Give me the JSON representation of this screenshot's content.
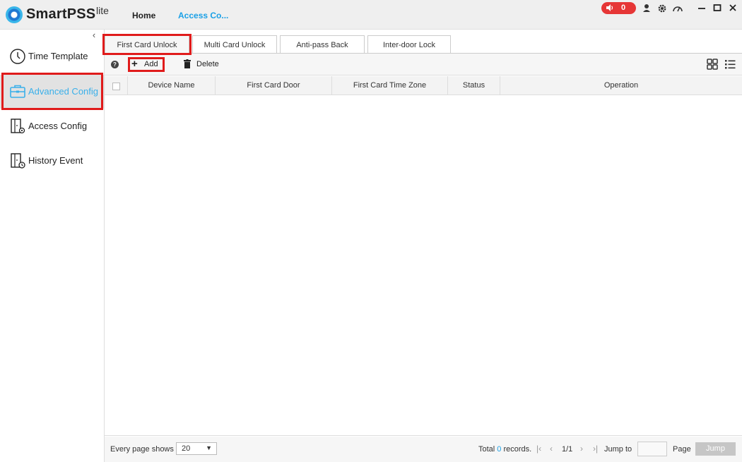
{
  "app": {
    "brand": "SmartPSS",
    "brand_sup": "lite",
    "nav": {
      "home": "Home",
      "access": "Access Co..."
    },
    "alarm_count": "0",
    "colors": {
      "accent": "#1aa0e6",
      "alarm": "#e63636",
      "highlight": "#e01b1b"
    },
    "icons": [
      "user-icon",
      "gear-icon",
      "speedometer-icon",
      "minimize-icon",
      "maximize-icon",
      "close-icon"
    ]
  },
  "sidebar": {
    "items": [
      {
        "label": "Time Template",
        "icon": "clock-icon"
      },
      {
        "label": "Advanced Config",
        "icon": "briefcase-icon"
      },
      {
        "label": "Access Config",
        "icon": "door-gear-icon"
      },
      {
        "label": "History Event",
        "icon": "door-clock-icon"
      }
    ]
  },
  "tabs": [
    {
      "label": "First Card Unlock"
    },
    {
      "label": "Multi Card Unlock"
    },
    {
      "label": "Anti-pass Back"
    },
    {
      "label": "Inter-door Lock"
    }
  ],
  "toolbar": {
    "help": "?",
    "add_label": "Add",
    "delete_label": "Delete"
  },
  "table": {
    "columns": [
      "Device Name",
      "First Card Door",
      "First Card Time Zone",
      "Status",
      "Operation"
    ],
    "rows": []
  },
  "footer": {
    "page_shows_label": "Every page shows",
    "page_size": "20",
    "total_prefix": "Total ",
    "total_count": "0",
    "total_suffix": " records.",
    "page_indicator": "1/1",
    "jump_to_label": "Jump to",
    "page_label": "Page",
    "jump_button": "Jump"
  }
}
